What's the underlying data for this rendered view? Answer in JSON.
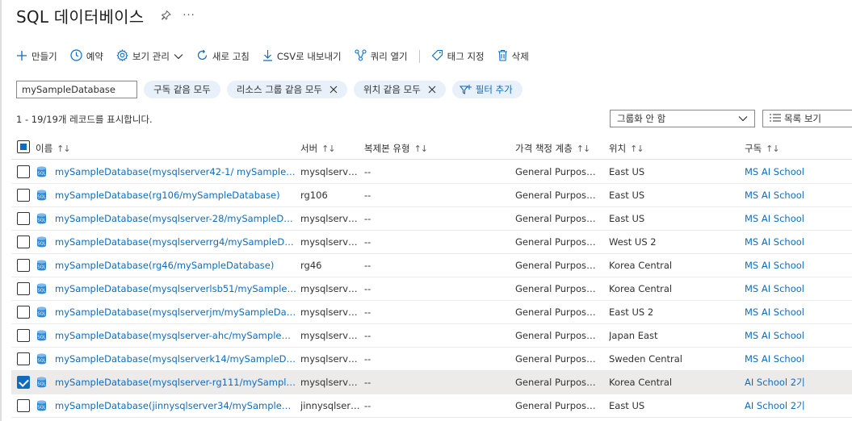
{
  "page": {
    "title": "SQL 데이터베이스",
    "more": "···"
  },
  "toolbar": {
    "create": "만들기",
    "reservations": "예약",
    "manage_view": "보기 관리",
    "refresh": "새로 고침",
    "export_csv": "CSV로 내보내기",
    "open_query": "쿼리 열기",
    "assign_tags": "태그 지정",
    "delete": "삭제"
  },
  "filters": {
    "search_value": "mySampleDatabase",
    "subscription": "구독 같음 모두",
    "resource_group": "리소스 그룹 같음 모두",
    "location": "위치 같음 모두",
    "add_filter": "필터 추가"
  },
  "summary": {
    "record_count": "1 - 19/19개 레코드를 표시합니다.",
    "group_by": "그룹화 안 함",
    "view_mode": "목록 보기"
  },
  "columns": {
    "name": "이름",
    "server": "서버",
    "replica_type": "복제본 유형",
    "pricing_tier": "가격 책정 계층",
    "location": "위치",
    "subscription": "구독",
    "sort_glyph": "↑↓"
  },
  "rows": [
    {
      "name": "mySampleDatabase(mysqlserver42-1/ mySampleDatab…",
      "server": "mysqlserver…",
      "replica": "--",
      "tier": "General Purpose: S…",
      "location": "East US",
      "subscription": "MS AI School",
      "checked": false
    },
    {
      "name": "mySampleDatabase(rg106/mySampleDatabase)",
      "server": "rg106",
      "replica": "--",
      "tier": "General Purpose: G…",
      "location": "East US",
      "subscription": "MS AI School",
      "checked": false
    },
    {
      "name": "mySampleDatabase(mysqlserver-28/mySampleDatabase)",
      "server": "mysqlserver…",
      "replica": "--",
      "tier": "General Purpose: S…",
      "location": "East US",
      "subscription": "MS AI School",
      "checked": false
    },
    {
      "name": "mySampleDatabase(mysqlserverrg4/mySampleDatabase)",
      "server": "mysqlserver…",
      "replica": "--",
      "tier": "General Purpose: S…",
      "location": "West US 2",
      "subscription": "MS AI School",
      "checked": false
    },
    {
      "name": "mySampleDatabase(rg46/mySampleDatabase)",
      "server": "rg46",
      "replica": "--",
      "tier": "General Purpose: S…",
      "location": "Korea Central",
      "subscription": "MS AI School",
      "checked": false
    },
    {
      "name": "mySampleDatabase(mysqlserverlsb51/mySampleDatab…",
      "server": "mysqlserver…",
      "replica": "--",
      "tier": "General Purpose: S…",
      "location": "Korea Central",
      "subscription": "MS AI School",
      "checked": false
    },
    {
      "name": "mySampleDatabase(mysqlserverjm/mySampleDatabase)",
      "server": "mysqlserver…",
      "replica": "--",
      "tier": "General Purpose: S…",
      "location": "East US 2",
      "subscription": "MS AI School",
      "checked": false
    },
    {
      "name": "mySampleDatabase(mysqlserver-ahc/mySampleDataba…",
      "server": "mysqlserver…",
      "replica": "--",
      "tier": "General Purpose: G…",
      "location": "Japan East",
      "subscription": "MS AI School",
      "checked": false
    },
    {
      "name": "mySampleDatabase(mysqlserverk14/mySampleDatabase)",
      "server": "mysqlserver…",
      "replica": "--",
      "tier": "General Purpose: G…",
      "location": "Sweden Central",
      "subscription": "MS AI School",
      "checked": false
    },
    {
      "name": "mySampleDatabase(mysqlserver-rg111/mySampleData…",
      "server": "mysqlserver…",
      "replica": "--",
      "tier": "General Purpose: S…",
      "location": "Korea Central",
      "subscription": "AI School 2기",
      "checked": true
    },
    {
      "name": "mySampleDatabase(jinnysqlserver34/mySampleDatabas…",
      "server": "jinnysqlserv…",
      "replica": "--",
      "tier": "General Purpose: S…",
      "location": "East US",
      "subscription": "AI School 2기",
      "checked": false
    }
  ],
  "colors": {
    "accent": "#0f6cbd",
    "link": "#0f6cbd",
    "pill_bg": "#e8f0f9",
    "selected_row": "#edebe9"
  },
  "icons": [
    "pin-icon",
    "plus-icon",
    "clock-icon",
    "gear-icon",
    "chevron-down-icon",
    "refresh-icon",
    "download-icon",
    "query-icon",
    "tag-icon",
    "trash-icon",
    "close-icon",
    "filter-add-icon",
    "list-icon",
    "database-icon"
  ]
}
